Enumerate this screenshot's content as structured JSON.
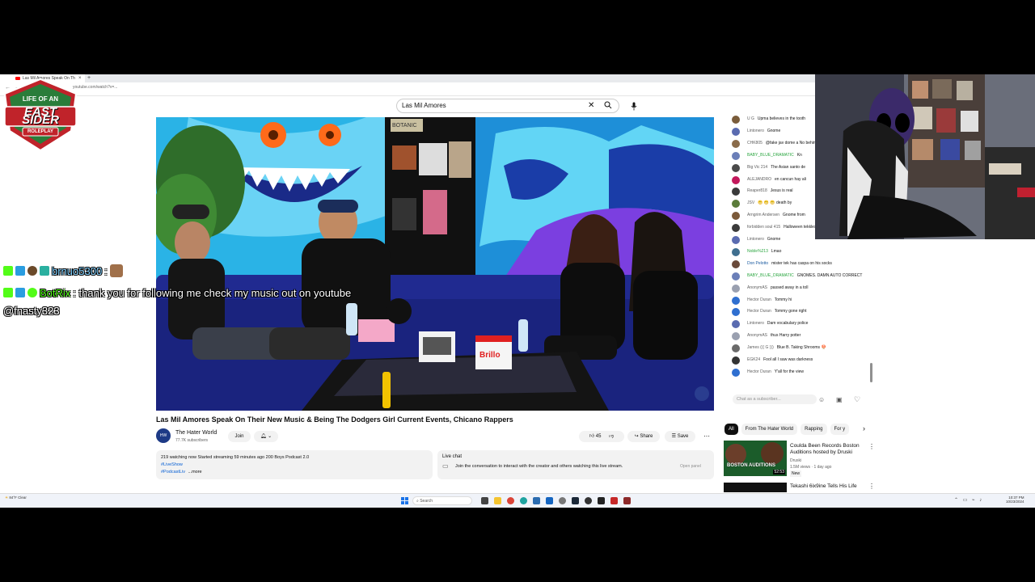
{
  "browser": {
    "tab_title": "Las Mil Amores Speak On Th",
    "url": "youtube.com/watch?v=..."
  },
  "search": {
    "query": "Las Mil Amores"
  },
  "video": {
    "title": "Las Mil Amores Speak On Their New Music & Being The Dodgers Girl Current Events, Chicano Rappers",
    "sign_text": "BOTANIC",
    "box_text": "Brillo"
  },
  "channel": {
    "name": "The Hater World",
    "subscribers": "77.7K subscribers",
    "join_label": "Join",
    "avatar_text": "HW"
  },
  "actions": {
    "likes": "45",
    "share_label": "Share",
    "save_label": "Save"
  },
  "description": {
    "stats": "219 watching now  Started streaming 59 minutes ago  200 Boys Podcast 2.0",
    "tag1": "#LiveShow",
    "tag2": "#PodcastLiv",
    "more": "...more"
  },
  "live_chat_panel": {
    "title": "Live chat",
    "text": "Join the conversation to interact with the creator and others watching this live stream.",
    "open_label": "Open panel"
  },
  "chat": {
    "messages": [
      {
        "author": "U G",
        "text": "Upma believes in the tooth",
        "color": "#7a5c3a",
        "role": ""
      },
      {
        "author": "Lintonero",
        "text": "Gnome",
        "color": "#5a6bb0",
        "role": ""
      },
      {
        "author": "CHK805",
        "text": "@fake jav dome a No behind a tree",
        "color": "#8a6b4a",
        "role": ""
      },
      {
        "author": "BABY_BLUE_DRAMATIC",
        "text": "Kn",
        "color": "#6b7fb8",
        "role": "mod"
      },
      {
        "author": "Big Vic 214",
        "text": "The Asian santo de",
        "color": "#4a4a4a",
        "role": ""
      },
      {
        "author": "ALEJANDRO",
        "text": "en cancun hay ali",
        "color": "#c2185b",
        "role": ""
      },
      {
        "author": "Reaper818",
        "text": "Jesus is real",
        "color": "#3a3a3a",
        "role": ""
      },
      {
        "author": "JSV",
        "text": "😬 😬 😬 death by",
        "color": "#5b7c3a",
        "role": ""
      },
      {
        "author": "Arngrim Andersen",
        "text": "Gnome from",
        "color": "#7b5a3a",
        "role": ""
      },
      {
        "author": "forbidden soul 415",
        "text": "Halloween tekkles pinga",
        "color": "#3b3b3b",
        "role": ""
      },
      {
        "author": "Lintonero",
        "text": "Gnome",
        "color": "#5a6bb0",
        "role": ""
      },
      {
        "author": "Noble%213",
        "text": "Lmao",
        "color": "#3f6f8f",
        "role": "mod"
      },
      {
        "author": "Don Pelotto",
        "text": "mister tek has caspa on his socks",
        "color": "#6a4a3a",
        "role": "own"
      },
      {
        "author": "BABY_BLUE_DRAMATIC",
        "text": "GNOMES. DAMN AUTO CORRECT",
        "color": "#6b7fb8",
        "role": "mod"
      },
      {
        "author": "AnonymAS",
        "text": "passed away in a toll",
        "color": "#9aa0b0",
        "role": ""
      },
      {
        "author": "Hector Duran",
        "text": "Tommy hi",
        "color": "#2f6fd0",
        "role": ""
      },
      {
        "author": "Hector Duran",
        "text": "Tommy gone right",
        "color": "#2f6fd0",
        "role": ""
      },
      {
        "author": "Lintonero",
        "text": "Dam vocabulary police",
        "color": "#5a6bb0",
        "role": ""
      },
      {
        "author": "AnonymAS",
        "text": "thus Harry potter",
        "color": "#9aa0b0",
        "role": ""
      },
      {
        "author": "James ((( G )))",
        "text": "Blue B. Taking Shrooms 🍄",
        "color": "#6a6a6a",
        "role": ""
      },
      {
        "author": "EGK24",
        "text": "Fool all I saw was darkness",
        "color": "#333333",
        "role": ""
      },
      {
        "author": "Hector Duran",
        "text": "Y'all for the view",
        "color": "#2f6fd0",
        "role": ""
      }
    ],
    "input_placeholder": "Chat as a subscriber..."
  },
  "filters": [
    "All",
    "From The Hater World",
    "Rapping",
    "For y"
  ],
  "recommendations": [
    {
      "title": "Coulda Been Records Boston Auditions hosted by Druski",
      "channel": "Druski",
      "meta": "1.5M views · 1 day ago",
      "badge": "New",
      "duration": "52:53",
      "thumb_text": "BOSTON AUDITIONS"
    },
    {
      "title": "Tekashi 6ix9ine Tells His Life",
      "channel": "",
      "meta": "",
      "badge": "",
      "duration": "",
      "thumb_text": ""
    }
  ],
  "overlay": {
    "logo_top": "LIFE OF AN",
    "logo_main": "EAST SIDER",
    "logo_sub": "ROLEPLAY",
    "line1_user": "brnuo5300",
    "line1_sep": ":",
    "line2_user": "BotRix",
    "line2_text": ": thank you for following me check my music out on youtube",
    "line3_text": "@fnasty323"
  },
  "taskbar": {
    "search_label": "Search",
    "weather": "84°F Clear",
    "time": "10:37 PM",
    "date": "10/23/2024"
  },
  "colors": {
    "youtube_red": "#ff0000",
    "link_blue": "#065fd4",
    "kick_green": "#53fc18",
    "logo_red": "#c0232a"
  }
}
